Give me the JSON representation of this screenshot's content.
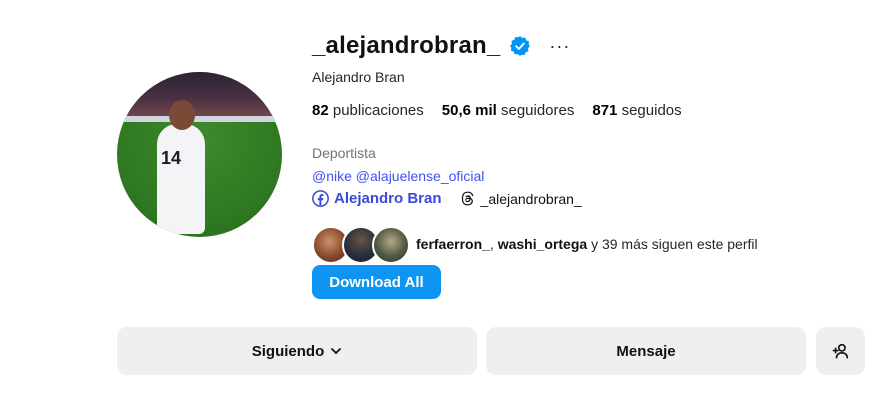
{
  "profile": {
    "username": "_alejandrobran_",
    "full_name": "Alejandro Bran",
    "more_label": "···",
    "stats": {
      "posts_count": "82",
      "posts_label": "publicaciones",
      "followers_count": "50,6 mil",
      "followers_label": "seguidores",
      "following_count": "871",
      "following_label": "seguidos"
    },
    "category": "Deportista",
    "mentions": [
      "@nike",
      "@alajuelense_oficial"
    ],
    "facebook_link": "Alejandro Bran",
    "threads_link": "_alejandrobran_",
    "followed_by": {
      "user1": "ferfaerron_",
      "separator": ", ",
      "user2": "washi_ortega",
      "rest": " y 39 más siguen este perfil"
    }
  },
  "avatar_jersey_number": "14",
  "actions": {
    "download_all": "Download All",
    "following": "Siguiendo",
    "message": "Mensaje"
  },
  "colors": {
    "verified": "#0095f6",
    "download_button": "#0d95f1",
    "link": "#4150f7",
    "secondary_button": "#efefef"
  }
}
